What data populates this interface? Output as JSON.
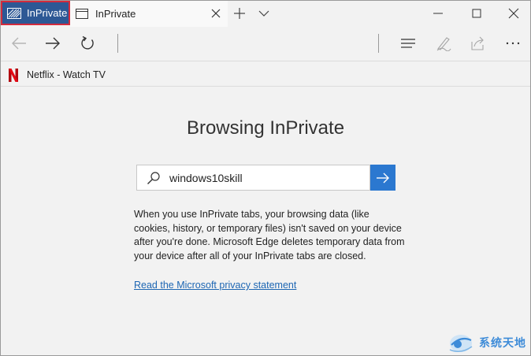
{
  "titlebar": {
    "badge_label": "InPrivate",
    "tab_title": "InPrivate"
  },
  "favorites": {
    "items": [
      {
        "label": "Netflix - Watch TV",
        "icon": "netflix-icon"
      }
    ]
  },
  "content": {
    "title": "Browsing InPrivate",
    "search": {
      "value": "windows10skill",
      "placeholder": ""
    },
    "description": "When you use InPrivate tabs, your browsing data (like cookies, history, or temporary files) isn't saved on your device after you're done. Microsoft Edge deletes temporary data from your device after all of your InPrivate tabs are closed.",
    "privacy_link": "Read the Microsoft privacy statement"
  },
  "watermark": {
    "text": "系统天地"
  },
  "colors": {
    "inprivate_badge": "#2d5895",
    "badge_outline": "#d32b3c",
    "accent": "#2b78d0",
    "link": "#1d66b3"
  }
}
